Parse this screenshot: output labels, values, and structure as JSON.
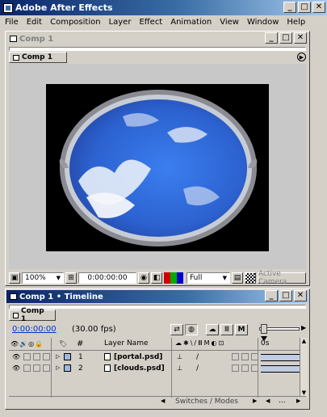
{
  "app": {
    "title": "Adobe After Effects"
  },
  "menu": [
    "File",
    "Edit",
    "Composition",
    "Layer",
    "Effect",
    "Animation",
    "View",
    "Window",
    "Help"
  ],
  "comp_window": {
    "title": "Comp 1",
    "tab_label": "Comp 1",
    "zoom": "100%",
    "timecode": "0:00:00:00",
    "resolution": "Full",
    "camera": "Active Camera"
  },
  "timeline": {
    "title": "Comp 1 • Timeline",
    "tab_label": "Comp 1",
    "timecode": "0:00:00:00",
    "fps": "(30.00 fps)",
    "col_number": "#",
    "col_layer_name": "Layer Name",
    "ruler_label": "0s",
    "switches_label": "Switches / Modes",
    "layers": [
      {
        "number": "1",
        "name": "[portal.psd]",
        "color": "#a0b8e0"
      },
      {
        "number": "2",
        "name": "[clouds.psd]",
        "color": "#a0b8e0"
      }
    ]
  },
  "colors": {
    "title_active_start": "#0a246a",
    "title_active_end": "#a6caf0",
    "face": "#d4d0c8",
    "sky": "#2f6fd8"
  }
}
